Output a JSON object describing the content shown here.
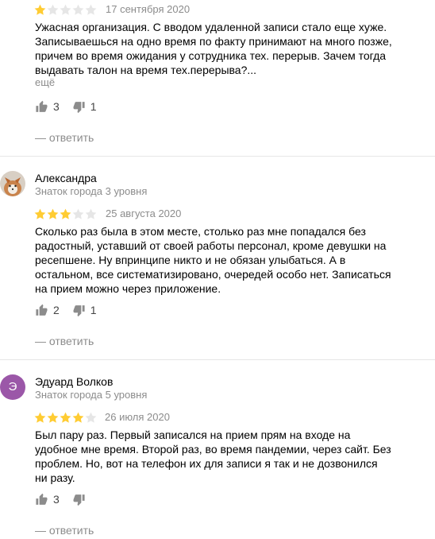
{
  "colors": {
    "star_filled": "#fc3",
    "star_empty": "#e6e6e6",
    "muted_text": "#8c8c8c",
    "icon": "#8c8c8c",
    "avatar_letter_bg": "#9b57a8"
  },
  "reviews": [
    {
      "rating": 1,
      "max_rating": 5,
      "date": "17 сентября 2020",
      "text": "Ужасная организация. С вводом удаленной записи стало еще хуже. Записываешься на одно время по факту принимают на много позже, причем во время ожидания у сотрудника тех. перерыв. Зачем тогда выдавать талон на время тех.перерыва?...",
      "more_label": "ещё",
      "likes": "3",
      "dislikes": "1",
      "reply_label": "— ответить",
      "like_icon": "thumbs-up-icon",
      "dislike_icon": "thumbs-down-icon"
    },
    {
      "author": "Александра",
      "level": "Знаток города 3 уровня",
      "avatar": "photo",
      "rating": 3,
      "max_rating": 5,
      "date": "25 августа 2020",
      "text": "Сколько раз была в этом месте, столько раз мне попадался без радостный, уставший от своей работы персонал, кроме девушки на ресепшене. Ну впринципе никто и не обязан улыбаться. А в остальном, все систематизировано, очередей особо нет. Записаться на прием можно через приложение.",
      "likes": "2",
      "dislikes": "1",
      "reply_label": "— ответить"
    },
    {
      "author": "Эдуард Волков",
      "level": "Знаток города 5 уровня",
      "avatar_letter": "Э",
      "rating": 4,
      "max_rating": 5,
      "date": "26 июля 2020",
      "text": "Был пару раз. Первый записался на прием прям на входе на удобное мне время. Второй раз, во время пандемии, через сайт. Без проблем. Но, вот на телефон их для записи я так и не дозвонился ни разу.",
      "likes": "3",
      "dislikes": "",
      "reply_label": "— ответить"
    }
  ]
}
